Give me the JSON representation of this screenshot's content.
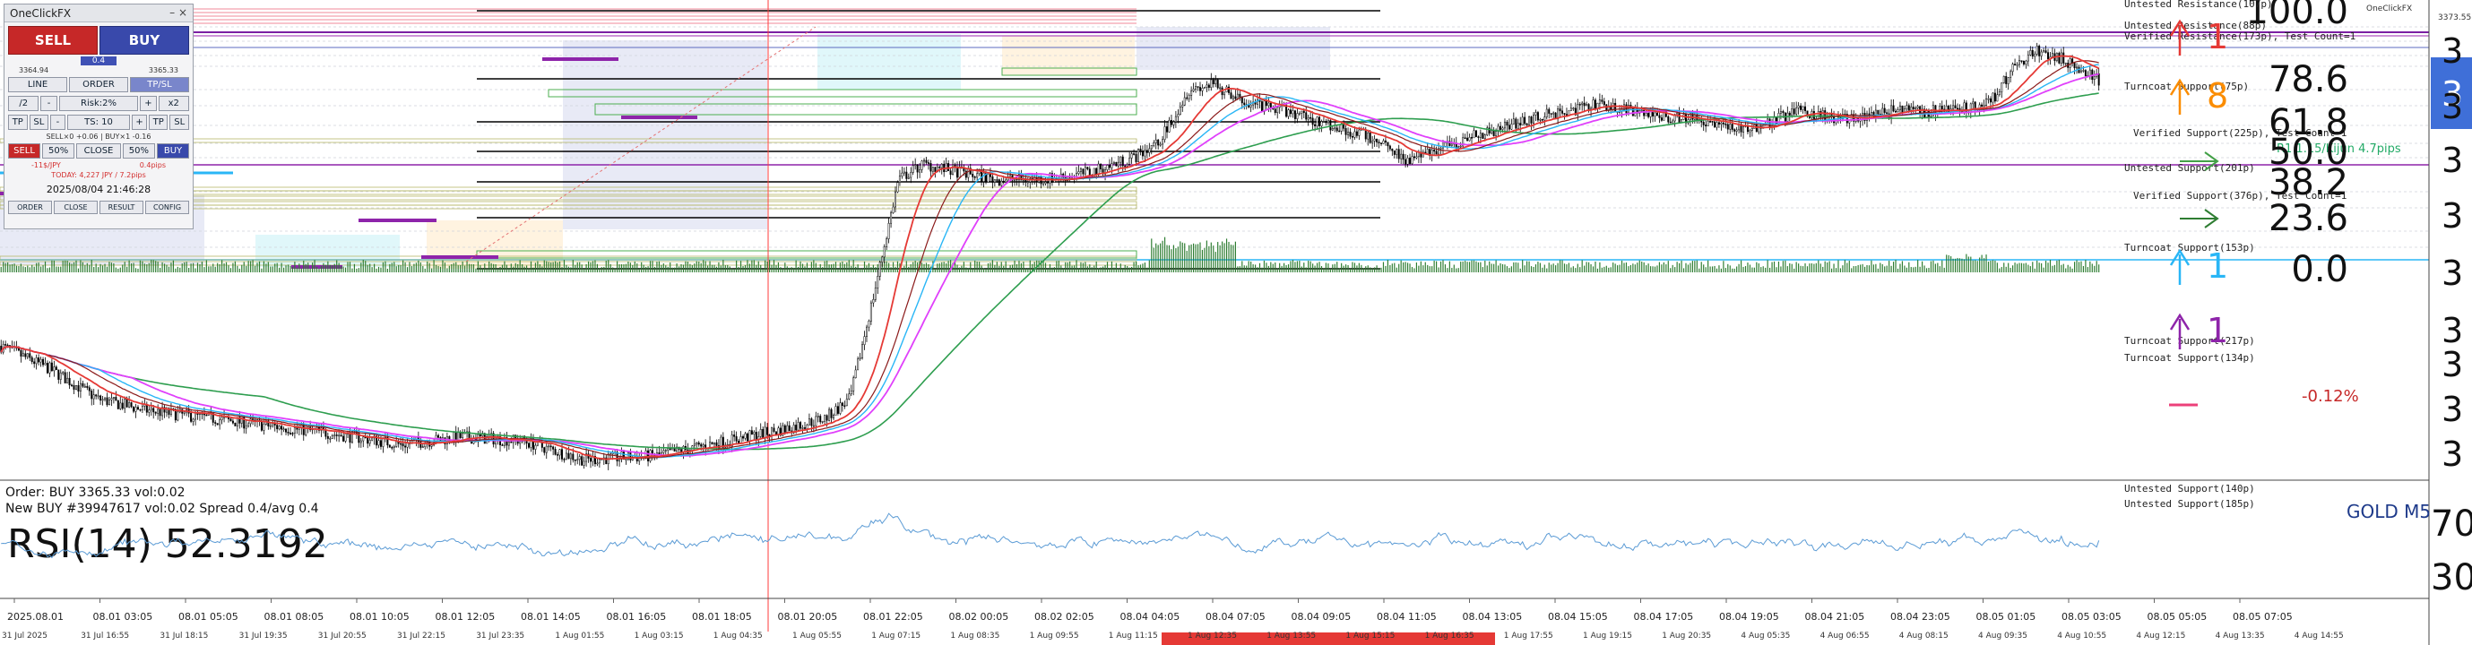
{
  "panel": {
    "title": "OneClickFX",
    "controls": "– ×",
    "sell_label": "SELL",
    "buy_label": "BUY",
    "lot": "0.4",
    "bid": "3364.94",
    "ask": "3365.33",
    "tabs": [
      "LINE",
      "ORDER",
      "TP/SL"
    ],
    "half": "/2",
    "risk": "Risk:2%",
    "minus": "-",
    "plus": "+",
    "x2": "x2",
    "tp": "TP",
    "sl": "SL",
    "ts": "TS: 10",
    "pos_info": "SELL×0 +0.06 | BUY×1 -0.16",
    "btn_sell": "SELL",
    "btn_50a": "50%",
    "btn_close": "CLOSE",
    "btn_50b": "50%",
    "btn_buy": "BUY",
    "pl_jpy": "-11$/JPY",
    "pl_pips": "0.4pips",
    "today": "TODAY: 4,227 JPY / 7.2pips",
    "datetime": "2025/08/04  21:46:28",
    "bottom_tabs": [
      "ORDER",
      "CLOSE",
      "RESULT",
      "CONFIG"
    ]
  },
  "chart_data": {
    "type": "candlestick",
    "symbol": "GOLD M5",
    "order_info": "Order: BUY 3365.33 vol:0.02",
    "new_info": "New BUY #39947617 vol:0.02 Spread 0.4/avg 0.4",
    "top_right_time": "3373.55",
    "top_right_label": "OneClickFX",
    "rsi_label": "RSI(14) 52.3192",
    "rsi_value": 52.3192,
    "rsi_levels": [
      "70",
      "30"
    ],
    "fib_levels": [
      {
        "label": "100.0",
        "value": 100.0
      },
      {
        "label": "78.6",
        "value": 78.6
      },
      {
        "label": "61.8",
        "value": 61.8
      },
      {
        "label": "50.0",
        "value": 50.0
      },
      {
        "label": "38.2",
        "value": 38.2
      },
      {
        "label": "23.6",
        "value": 23.6
      },
      {
        "label": "0.0",
        "value": 0.0
      }
    ],
    "change_pct": "-0.12%",
    "zone_labels": [
      "Untested Resistance(107p)",
      "Untested Resistance(88p)",
      "Verified Resistance(173p), Test Count=1",
      "Turncoat Support(75p)",
      "Verified Support(225p), Test Count=1",
      "Untested Support(201p)",
      "Verified Support(376p), Test Count=1",
      "Turncoat Support(153p)",
      "Turncoat Support(217p)",
      "Turncoat Support(134p)",
      "Untested Support(140p)",
      "Untested Support(185p)"
    ],
    "arrows": [
      {
        "dir": "up",
        "label": "1",
        "color": "#e53935"
      },
      {
        "dir": "up",
        "label": "8",
        "color": "#fb8c00"
      },
      {
        "dir": "right",
        "label": "",
        "color": "#43a047"
      },
      {
        "dir": "right",
        "label": "",
        "color": "#2e7d32"
      },
      {
        "dir": "up",
        "label": "1",
        "color": "#29b6f6"
      },
      {
        "dir": "up",
        "label": "1",
        "color": "#8e24aa"
      }
    ],
    "small_label": "R1 1.15/Kijun 4.7pips",
    "x_ticks_top": [
      "2025.08.01",
      "08.01 03:05",
      "08.01 05:05",
      "08.01 08:05",
      "08.01 10:05",
      "08.01 12:05",
      "08.01 14:05",
      "08.01 16:05",
      "08.01 18:05",
      "08.01 20:05",
      "08.01 22:05",
      "08.02 00:05",
      "08.02 02:05",
      "08.04 04:05",
      "08.04 07:05",
      "08.04 09:05",
      "08.04 11:05",
      "08.04 13:05",
      "08.04 15:05",
      "08.04 17:05",
      "08.04 19:05",
      "08.04 21:05",
      "08.04 23:05",
      "08.05 01:05",
      "08.05 03:05",
      "08.05 05:05",
      "08.05 07:05"
    ],
    "x_ticks_bottom": [
      "31 Jul 2025",
      "31 Jul 16:55",
      "31 Jul 18:15",
      "31 Jul 19:35",
      "31 Jul 20:55",
      "31 Jul 22:15",
      "31 Jul 23:35",
      "1 Aug 01:55",
      "1 Aug 03:15",
      "1 Aug 04:35",
      "1 Aug 05:55",
      "1 Aug 07:15",
      "1 Aug 08:35",
      "1 Aug 09:55",
      "1 Aug 11:15",
      "1 Aug 12:35",
      "1 Aug 13:55",
      "1 Aug 15:15",
      "1 Aug 16:35",
      "1 Aug 17:55",
      "1 Aug 19:15",
      "1 Aug 20:35",
      "4 Aug 05:35",
      "4 Aug 06:55",
      "4 Aug 08:15",
      "4 Aug 09:35",
      "4 Aug 10:55",
      "4 Aug 12:15",
      "4 Aug 13:35",
      "4 Aug 14:55"
    ],
    "colors": {
      "ma_red": "#e53935",
      "ma_magenta": "#e040fb",
      "ma_cyan": "#29b6f6",
      "ma_green": "#2e9e4f",
      "ma_darkred": "#8b1a1a",
      "candle": "#000000",
      "rsi": "#5b9bd5",
      "volume": "#2e7d32",
      "current_price_bg": "#3f6fd8",
      "vline": "#ff3b3b"
    },
    "price_axis_labels": [
      "3",
      "3",
      "3",
      "3",
      "3",
      "3",
      "3",
      "3",
      "3",
      "3"
    ],
    "current_price_label": "3"
  }
}
